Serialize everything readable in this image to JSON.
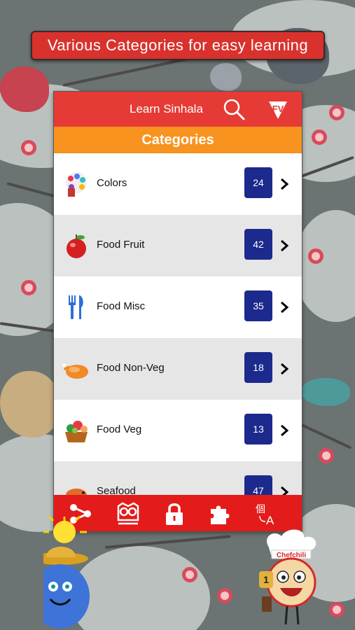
{
  "banner": {
    "text": "Various Categories for easy learning"
  },
  "app": {
    "title": "Learn Sinhala",
    "categories_header": "Categories"
  },
  "categories": [
    {
      "label": "Colors",
      "count": "24",
      "icon": "palette-icon"
    },
    {
      "label": "Food Fruit",
      "count": "42",
      "icon": "apple-icon"
    },
    {
      "label": "Food Misc",
      "count": "35",
      "icon": "fork-knife-icon"
    },
    {
      "label": "Food Non-Veg",
      "count": "18",
      "icon": "roast-chicken-icon"
    },
    {
      "label": "Food Veg",
      "count": "13",
      "icon": "vegetable-basket-icon"
    },
    {
      "label": "Seafood",
      "count": "47",
      "icon": "seafood-icon"
    }
  ],
  "tabs": [
    "share-icon",
    "owl-icon",
    "lock-icon",
    "puzzle-icon",
    "translate-icon"
  ],
  "mascot_chef_text": "Chefchili",
  "mascot_trophy_text": "1",
  "colors": {
    "appbar": "#e53a35",
    "category_bar": "#f7931e",
    "badge": "#1b2a8c",
    "tabbar": "#e31b1b",
    "banner": "#d9322d"
  }
}
